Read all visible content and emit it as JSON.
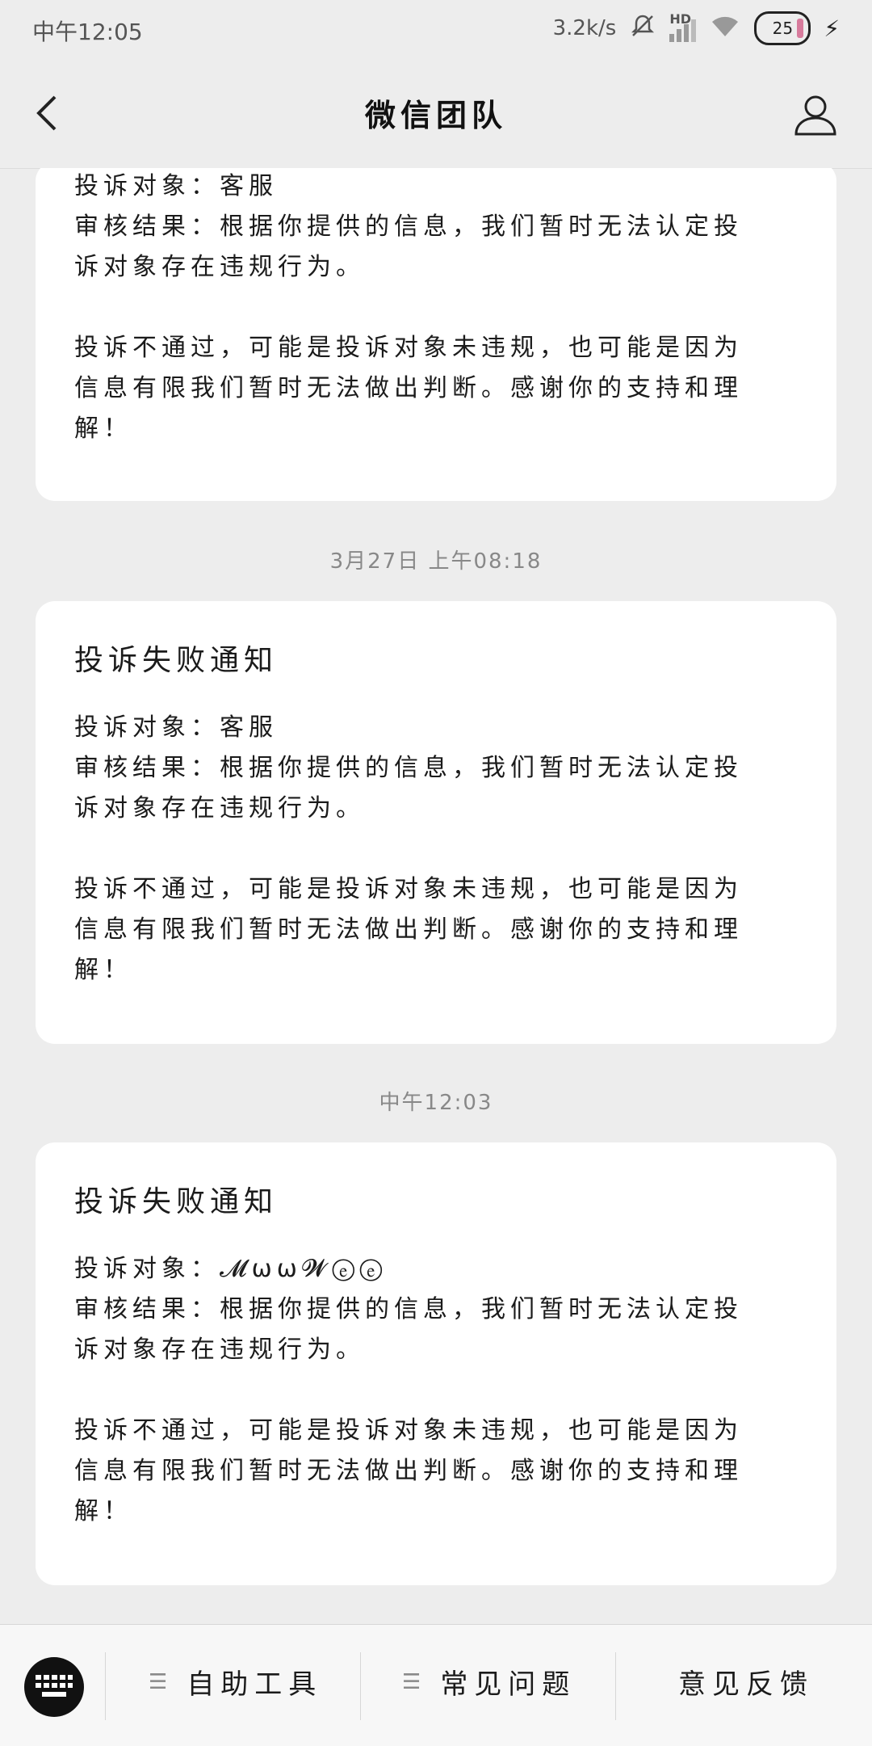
{
  "status_bar": {
    "time": "中午12:05",
    "net_speed": "3.2k/s",
    "hd_label": "HD",
    "battery": "25"
  },
  "nav": {
    "title": "微信团队"
  },
  "cards": [
    {
      "title": "",
      "target_line": "投诉对象：客服",
      "result_lines": [
        "审核结果：根据你提供的信息，我们暂时无法认定投",
        "诉对象存在违规行为。"
      ],
      "note_lines": [
        "投诉不通过，可能是投诉对象未违规，也可能是因为",
        "信息有限我们暂时无法做出判断。感谢你的支持和理",
        "解！"
      ]
    },
    {
      "timestamp": "3月27日 上午08:18",
      "title": "投诉失败通知",
      "target_line": "投诉对象：客服",
      "result_lines": [
        "审核结果：根据你提供的信息，我们暂时无法认定投",
        "诉对象存在违规行为。"
      ],
      "note_lines": [
        "投诉不通过，可能是投诉对象未违规，也可能是因为",
        "信息有限我们暂时无法做出判断。感谢你的支持和理",
        "解！"
      ]
    },
    {
      "timestamp": "中午12:03",
      "title": "投诉失败通知",
      "target_line": "投诉对象：𝓜ѡѡ𝓦ⓔⓔ",
      "result_lines": [
        "审核结果：根据你提供的信息，我们暂时无法认定投",
        "诉对象存在违规行为。"
      ],
      "note_lines": [
        "投诉不通过，可能是投诉对象未违规，也可能是因为",
        "信息有限我们暂时无法做出判断。感谢你的支持和理",
        "解！"
      ]
    }
  ],
  "bottom_menu": {
    "item1": "自助工具",
    "item2": "常见问题",
    "item3": "意见反馈"
  }
}
